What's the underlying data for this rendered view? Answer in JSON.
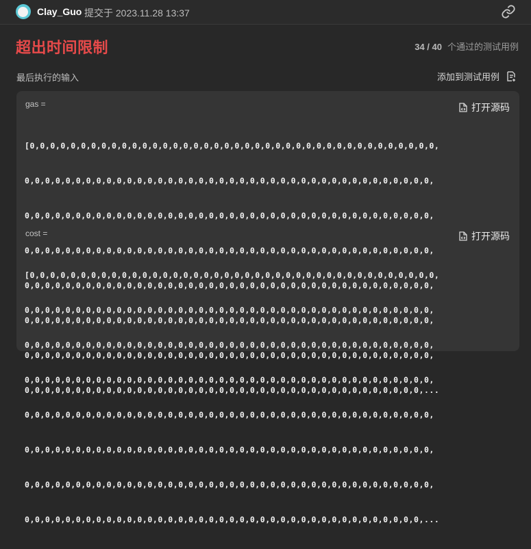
{
  "header": {
    "username": "Clay_Guo",
    "submitted_text": "提交于 2023.11.28 13:37",
    "link_icon": "link-icon"
  },
  "result": {
    "status": "超出时间限制",
    "passed_count": "34 / 40",
    "passed_suffix": "个通过的测试用例"
  },
  "last_input": {
    "label": "最后执行的输入",
    "add_testcase_label": "添加到测试用例",
    "add_testcase_icon": "add-testcase-icon"
  },
  "inputs": [
    {
      "name": "gas =",
      "open_source_label": "打开源码",
      "lines": [
        "[0,0,0,0,0,0,0,0,0,0,0,0,0,0,0,0,0,0,0,0,0,0,0,0,0,0,0,0,0,0,0,0,0,0,0,0,0,0,0,0,",
        "0,0,0,0,0,0,0,0,0,0,0,0,0,0,0,0,0,0,0,0,0,0,0,0,0,0,0,0,0,0,0,0,0,0,0,0,0,0,0,0,",
        "0,0,0,0,0,0,0,0,0,0,0,0,0,0,0,0,0,0,0,0,0,0,0,0,0,0,0,0,0,0,0,0,0,0,0,0,0,0,0,0,",
        "0,0,0,0,0,0,0,0,0,0,0,0,0,0,0,0,0,0,0,0,0,0,0,0,0,0,0,0,0,0,0,0,0,0,0,0,0,0,0,0,",
        "0,0,0,0,0,0,0,0,0,0,0,0,0,0,0,0,0,0,0,0,0,0,0,0,0,0,0,0,0,0,0,0,0,0,0,0,0,0,0,0,",
        "0,0,0,0,0,0,0,0,0,0,0,0,0,0,0,0,0,0,0,0,0,0,0,0,0,0,0,0,0,0,0,0,0,0,0,0,0,0,0,0,",
        "0,0,0,0,0,0,0,0,0,0,0,0,0,0,0,0,0,0,0,0,0,0,0,0,0,0,0,0,0,0,0,0,0,0,0,0,0,0,0,0,",
        "0,0,0,0,0,0,0,0,0,0,0,0,0,0,0,0,0,0,0,0,0,0,0,0,0,0,0,0,0,0,0,0,0,0,0,0,0,0,0,..."
      ]
    },
    {
      "name": "cost =",
      "open_source_label": "打开源码",
      "lines": [
        "[0,0,0,0,0,0,0,0,0,0,0,0,0,0,0,0,0,0,0,0,0,0,0,0,0,0,0,0,0,0,0,0,0,0,0,0,0,0,0,0,",
        "0,0,0,0,0,0,0,0,0,0,0,0,0,0,0,0,0,0,0,0,0,0,0,0,0,0,0,0,0,0,0,0,0,0,0,0,0,0,0,0,",
        "0,0,0,0,0,0,0,0,0,0,0,0,0,0,0,0,0,0,0,0,0,0,0,0,0,0,0,0,0,0,0,0,0,0,0,0,0,0,0,0,",
        "0,0,0,0,0,0,0,0,0,0,0,0,0,0,0,0,0,0,0,0,0,0,0,0,0,0,0,0,0,0,0,0,0,0,0,0,0,0,0,0,",
        "0,0,0,0,0,0,0,0,0,0,0,0,0,0,0,0,0,0,0,0,0,0,0,0,0,0,0,0,0,0,0,0,0,0,0,0,0,0,0,0,",
        "0,0,0,0,0,0,0,0,0,0,0,0,0,0,0,0,0,0,0,0,0,0,0,0,0,0,0,0,0,0,0,0,0,0,0,0,0,0,0,0,",
        "0,0,0,0,0,0,0,0,0,0,0,0,0,0,0,0,0,0,0,0,0,0,0,0,0,0,0,0,0,0,0,0,0,0,0,0,0,0,0,0,",
        "0,0,0,0,0,0,0,0,0,0,0,0,0,0,0,0,0,0,0,0,0,0,0,0,0,0,0,0,0,0,0,0,0,0,0,0,0,0,0,..."
      ]
    }
  ],
  "colors": {
    "error": "#e84a4a",
    "background": "#282828",
    "panel": "#353535"
  }
}
